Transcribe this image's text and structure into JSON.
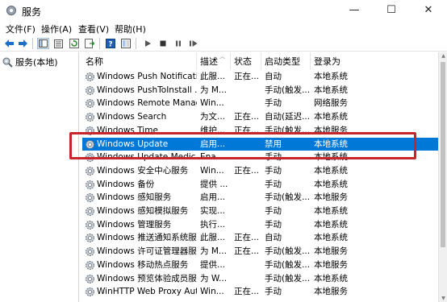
{
  "window": {
    "title": "服务",
    "min": "—",
    "max": "☐",
    "close": "✕"
  },
  "menu": [
    "文件(F)",
    "操作(A)",
    "查看(V)",
    "帮助(H)"
  ],
  "tree": {
    "label": "服务(本地)"
  },
  "columns": {
    "name": "名称",
    "desc": "描述",
    "status": "状态",
    "startup": "启动类型",
    "logon": "登录为"
  },
  "rows": [
    {
      "name": "Windows Push Notificati...",
      "desc": "此服...",
      "status": "正在...",
      "startup": "自动",
      "logon": "本地系统"
    },
    {
      "name": "Windows PushToInstall ...",
      "desc": "为 M...",
      "status": "",
      "startup": "手动(触发...",
      "logon": "本地系统"
    },
    {
      "name": "Windows Remote Manag...",
      "desc": "Win...",
      "status": "",
      "startup": "手动",
      "logon": "网络服务"
    },
    {
      "name": "Windows Search",
      "desc": "为文...",
      "status": "正在...",
      "startup": "自动(延迟...",
      "logon": "本地系统"
    },
    {
      "name": "Windows Time",
      "desc": "维护...",
      "status": "正在...",
      "startup": "手动(触发...",
      "logon": "本地服务"
    },
    {
      "name": "Windows Update",
      "desc": "启用...",
      "status": "",
      "startup": "禁用",
      "logon": "本地系统"
    },
    {
      "name": "Windows Update Medic ...",
      "desc": "Ena...",
      "status": "",
      "startup": "手动",
      "logon": "本地系统"
    },
    {
      "name": "Windows 安全中心服务",
      "desc": "Win...",
      "status": "正在...",
      "startup": "手动",
      "logon": "本地系统"
    },
    {
      "name": "Windows 备份",
      "desc": "提供 ...",
      "status": "",
      "startup": "手动",
      "logon": "本地系统"
    },
    {
      "name": "Windows 感知服务",
      "desc": "启用...",
      "status": "",
      "startup": "手动(触发...",
      "logon": "本地服务"
    },
    {
      "name": "Windows 感知模拟服务",
      "desc": "实现...",
      "status": "",
      "startup": "手动",
      "logon": "本地系统"
    },
    {
      "name": "Windows 管理服务",
      "desc": "执行...",
      "status": "",
      "startup": "手动",
      "logon": "本地系统"
    },
    {
      "name": "Windows 推送通知系统服务",
      "desc": "此服...",
      "status": "正在...",
      "startup": "自动",
      "logon": "本地系统"
    },
    {
      "name": "Windows 许可证管理器服务",
      "desc": "为 M...",
      "status": "正在...",
      "startup": "手动(触发...",
      "logon": "本地服务"
    },
    {
      "name": "Windows 移动热点服务",
      "desc": "提供...",
      "status": "",
      "startup": "手动(触发...",
      "logon": "本地服务"
    },
    {
      "name": "Windows 预览体验成员服务",
      "desc": "为 W...",
      "status": "",
      "startup": "手动(触发...",
      "logon": "本地系统"
    },
    {
      "name": "WinHTTP Web Proxy Aut...",
      "desc": "Win...",
      "status": "正在...",
      "startup": "手动",
      "logon": "本地服务"
    }
  ],
  "selected_row": "Windows Update",
  "colors": {
    "selection": "#0078d7",
    "highlight_box": "#c8242b"
  }
}
